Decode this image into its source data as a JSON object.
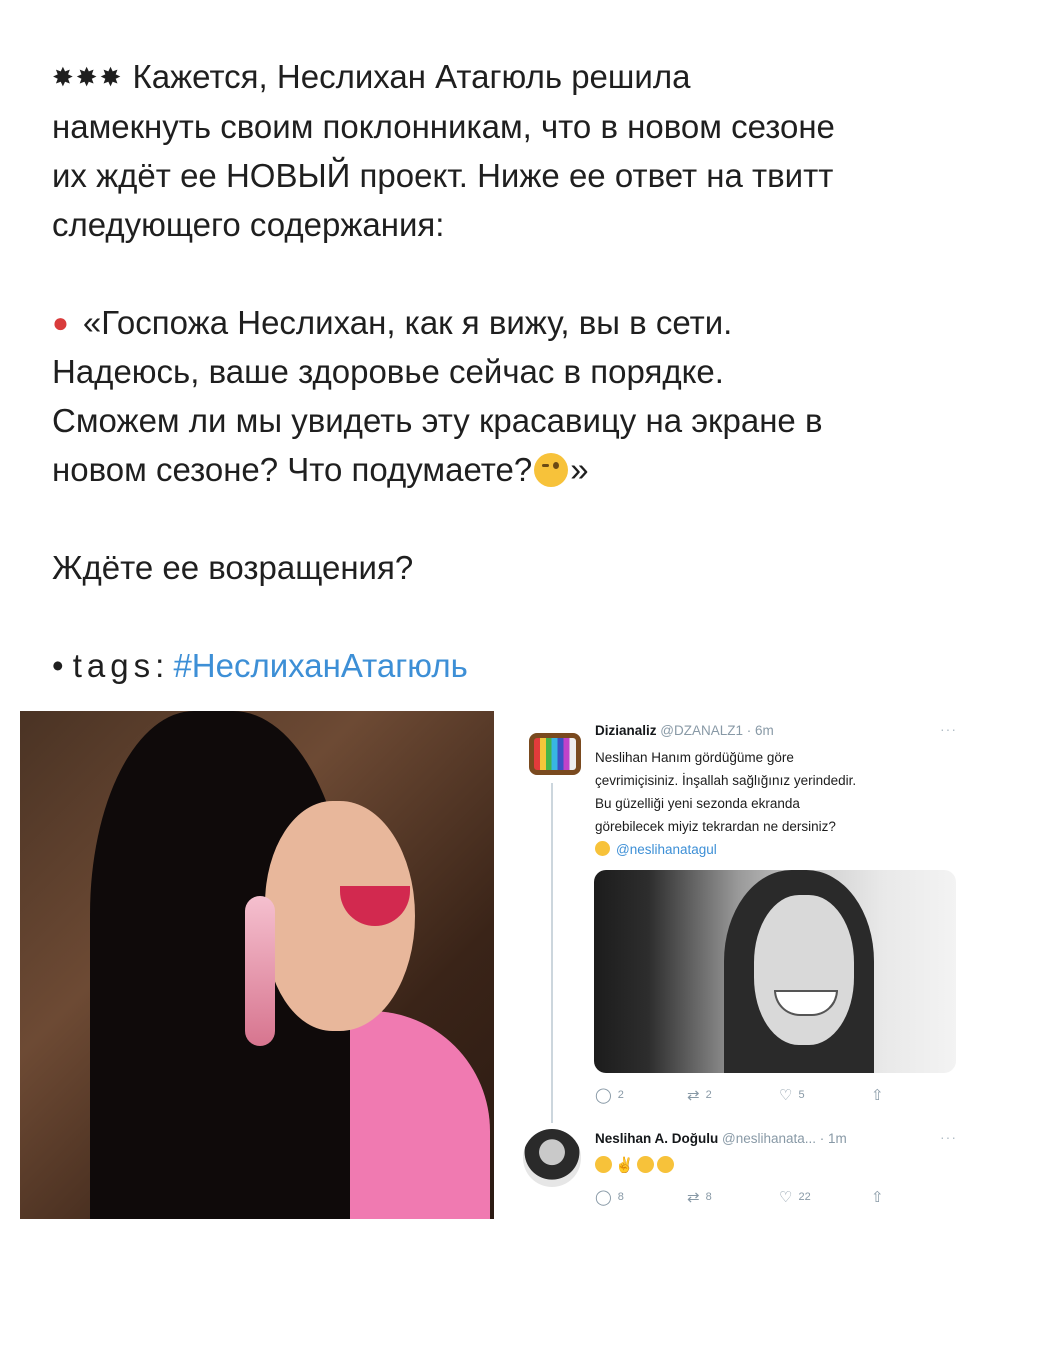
{
  "post": {
    "line1_emojis": "💥💥💥",
    "line1": "Кажется, Неслихан Атагюль решила",
    "line2": "намекнуть своим поклонникам, что в новом сезоне",
    "line3": "их ждёт ее НОВЫЙ проект. Ниже ее ответ на твитт",
    "line4": "следующего содержания:",
    "quote_pin": "📍",
    "quote1": "«Госпожа Неслихан, как я вижу, вы в сети.",
    "quote2": "Надеюсь, ваше здоровье сейчас в порядке.",
    "quote3": "Сможем ли мы увидеть эту красавицу на экране в",
    "quote4": "новом сезоне? Что подумаете?",
    "quote4_end": "»",
    "question": "Ждёте ее возращения?",
    "tags_bullet": "•",
    "tags_label": "tags",
    "tags_colon": ":",
    "hashtag": "#НеслиханАтагюль"
  },
  "tweet1": {
    "name": "Dizianaliz",
    "handle": "@DZANALZ1 · 6m",
    "more": "···",
    "line1": "Neslihan Hanım gördüğüme göre",
    "line2": "çevrimiçisiniz. İnşallah sağlığınız yerindedir.",
    "line3": "Bu güzelliği yeni sezonda ekranda",
    "line4": "görebilecek miyiz tekrardan ne dersiniz?",
    "mention": "@neslihanatagul",
    "replies": "2",
    "retweets": "2",
    "likes": "5"
  },
  "tweet2": {
    "name": "Neslihan A. Doğulu",
    "handle": "@neslihanata... · 1m",
    "more": "···",
    "emojis": "😊🤘😯😊",
    "replies": "8",
    "retweets": "8",
    "likes": "22"
  },
  "icons": {
    "reply": "reply-icon",
    "retweet": "retweet-icon",
    "like": "heart-icon",
    "share": "share-icon"
  },
  "colors": {
    "hashtag": "#3d8fd6",
    "text": "#1f1f1f",
    "muted": "#8899a6"
  }
}
